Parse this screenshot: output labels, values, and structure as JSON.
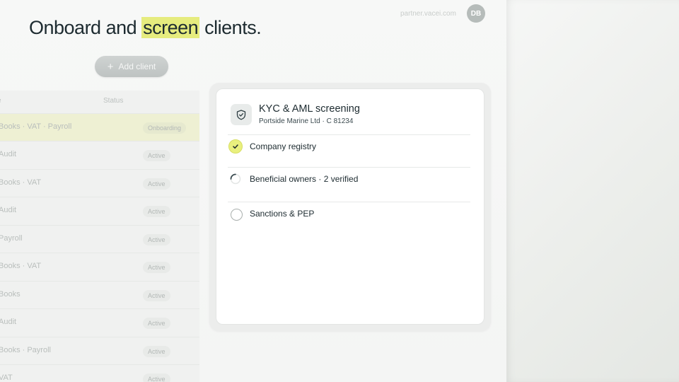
{
  "header": {
    "headline_prefix": "Onboard and ",
    "headline_highlight": "screen",
    "headline_suffix": " clients.",
    "domain": "partner.vacei.com",
    "avatar_initials": "DB"
  },
  "toolbar": {
    "add_client_label": "Add client"
  },
  "table": {
    "columns": [
      "e",
      "Status"
    ],
    "rows": [
      {
        "services": "Books · VAT · Payroll",
        "status": "Onboarding"
      },
      {
        "services": "Audit",
        "status": "Active"
      },
      {
        "services": "Books · VAT",
        "status": "Active"
      },
      {
        "services": "Audit",
        "status": "Active"
      },
      {
        "services": "Payroll",
        "status": "Active"
      },
      {
        "services": "Books · VAT",
        "status": "Active"
      },
      {
        "services": "Books",
        "status": "Active"
      },
      {
        "services": "Audit",
        "status": "Active"
      },
      {
        "services": "Books · Payroll",
        "status": "Active"
      },
      {
        "services": "VAT",
        "status": "Active"
      }
    ]
  },
  "screening": {
    "title": "KYC & AML screening",
    "subtitle": "Portside Marine Ltd · C 81234",
    "checks": [
      {
        "label": "Company registry",
        "state": "done"
      },
      {
        "label": "Beneficial owners · 2 verified",
        "state": "in-progress"
      },
      {
        "label": "Sanctions & PEP",
        "state": "pending"
      }
    ]
  },
  "colors": {
    "accent_highlight": "#e6ec7e",
    "check_done": "#e9f07e",
    "text_primary": "#1d2b30"
  },
  "icons": {
    "card": "shield-check-icon",
    "done": "checkmark-icon",
    "in_progress": "spinner-icon",
    "pending": "empty-circle-icon",
    "add": "plus-icon"
  }
}
